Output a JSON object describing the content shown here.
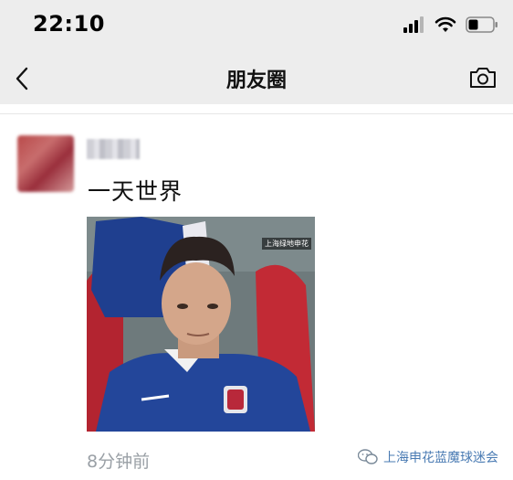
{
  "status_bar": {
    "time": "22:10"
  },
  "nav": {
    "title": "朋友圈"
  },
  "post": {
    "username": "",
    "text": "一天世界",
    "photo_caption": "上海绿地申花",
    "time_ago": "8分钟前"
  },
  "watermark": {
    "text": "上海申花蓝魔球迷会"
  },
  "colors": {
    "bar_bg": "#ededed",
    "text": "#111111",
    "muted": "#9aa0a6"
  },
  "icons": [
    "signal-icon",
    "wifi-icon",
    "battery-icon",
    "back-arrow-icon",
    "camera-icon",
    "wechat-logo-icon"
  ]
}
